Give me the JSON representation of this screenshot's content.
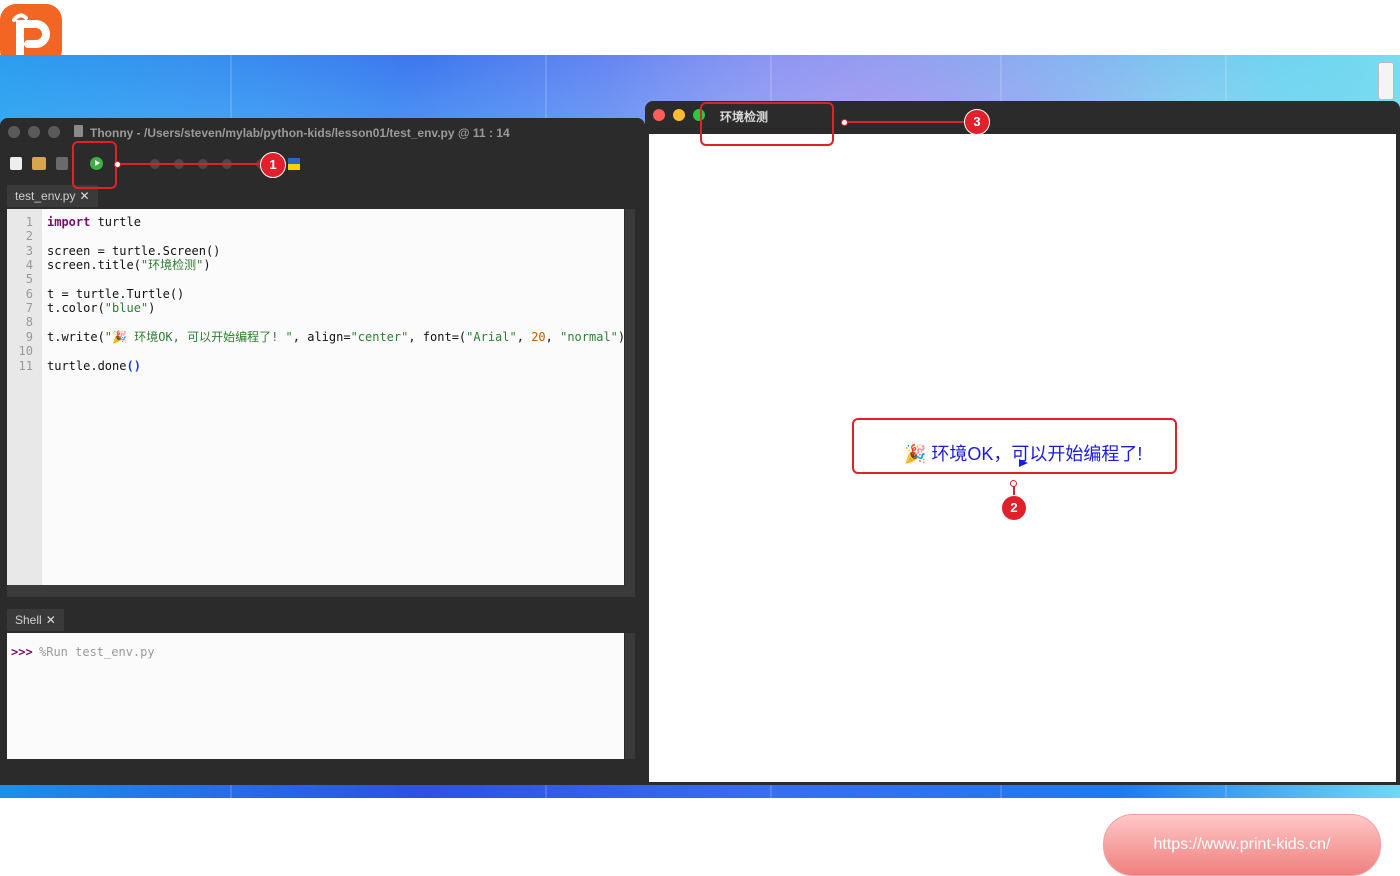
{
  "thonny": {
    "title": "Thonny  -  /Users/steven/mylab/python-kids/lesson01/test_env.py  @  11 : 14",
    "editor_tab": "test_env.py",
    "shell_tab": "Shell",
    "close_glyph": "✕",
    "code_lines": [
      {
        "n": "1",
        "segments": [
          {
            "t": "import",
            "c": "kw"
          },
          {
            "t": " turtle",
            "c": ""
          }
        ]
      },
      {
        "n": "2",
        "segments": []
      },
      {
        "n": "3",
        "segments": [
          {
            "t": "screen = turtle.Screen()",
            "c": ""
          }
        ]
      },
      {
        "n": "4",
        "segments": [
          {
            "t": "screen.title(",
            "c": ""
          },
          {
            "t": "\"环境检测\"",
            "c": "str"
          },
          {
            "t": ")",
            "c": ""
          }
        ]
      },
      {
        "n": "5",
        "segments": []
      },
      {
        "n": "6",
        "segments": [
          {
            "t": "t = turtle.Turtle()",
            "c": ""
          }
        ]
      },
      {
        "n": "7",
        "segments": [
          {
            "t": "t.color(",
            "c": ""
          },
          {
            "t": "\"blue\"",
            "c": "str"
          },
          {
            "t": ")",
            "c": ""
          }
        ]
      },
      {
        "n": "8",
        "segments": []
      },
      {
        "n": "9",
        "segments": [
          {
            "t": "t.write(",
            "c": ""
          },
          {
            "t": "\"🎉 环境OK, 可以开始编程了! \"",
            "c": "str"
          },
          {
            "t": ", align=",
            "c": ""
          },
          {
            "t": "\"center\"",
            "c": "str"
          },
          {
            "t": ", font=(",
            "c": ""
          },
          {
            "t": "\"Arial\"",
            "c": "str"
          },
          {
            "t": ", ",
            "c": ""
          },
          {
            "t": "20",
            "c": "num"
          },
          {
            "t": ", ",
            "c": ""
          },
          {
            "t": "\"normal\"",
            "c": "str"
          },
          {
            "t": ")",
            "c": ""
          }
        ]
      },
      {
        "n": "10",
        "segments": []
      },
      {
        "n": "11",
        "segments": [
          {
            "t": "turtle.done",
            "c": ""
          },
          {
            "t": "()",
            "c": "paren"
          }
        ]
      }
    ],
    "shell_prompt": ">>>",
    "shell_command": "%Run test_env.py"
  },
  "turtle_window": {
    "title": "环境检测",
    "message": "🎉 环境OK，可以开始编程了!"
  },
  "annotations": {
    "badge_1": "1",
    "badge_2": "2",
    "badge_3": "3",
    "color": "#e0202a"
  },
  "footer": {
    "url": "https://www.print-kids.cn/"
  },
  "colors": {
    "logo": "#f26522",
    "run_button": "#3cb043",
    "turtle_text": "#1a1ae0"
  }
}
